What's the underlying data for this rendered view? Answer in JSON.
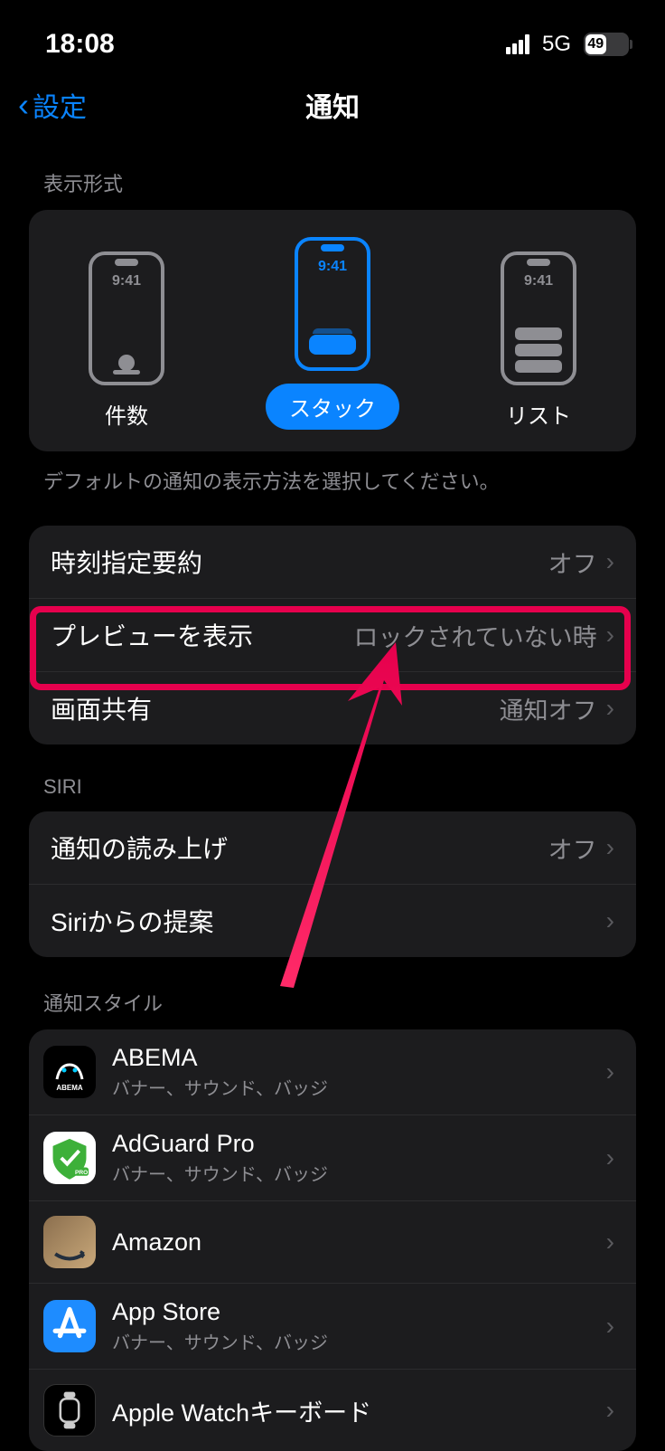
{
  "status": {
    "time": "18:08",
    "network": "5G",
    "battery_percent": "49",
    "battery_width": "49%"
  },
  "nav": {
    "back_label": "設定",
    "title": "通知"
  },
  "display_style": {
    "header": "表示形式",
    "phone_time": "9:41",
    "count_label": "件数",
    "stack_label": "スタック",
    "list_label": "リスト",
    "footer": "デフォルトの通知の表示方法を選択してください。"
  },
  "general": {
    "scheduled_summary_label": "時刻指定要約",
    "scheduled_summary_value": "オフ",
    "preview_label": "プレビューを表示",
    "preview_value": "ロックされていない時",
    "screen_share_label": "画面共有",
    "screen_share_value": "通知オフ"
  },
  "siri": {
    "header": "SIRI",
    "announce_label": "通知の読み上げ",
    "announce_value": "オフ",
    "suggestions_label": "Siriからの提案"
  },
  "style": {
    "header": "通知スタイル",
    "sub_full": "バナー、サウンド、バッジ",
    "apps": {
      "abema": "ABEMA",
      "adguard": "AdGuard Pro",
      "amazon": "Amazon",
      "appstore": "App Store",
      "watch": "Apple Watchキーボード"
    }
  }
}
